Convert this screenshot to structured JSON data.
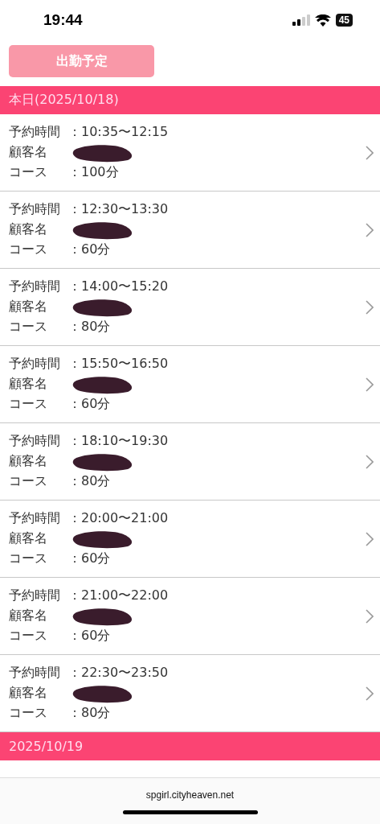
{
  "status_bar": {
    "time": "19:44",
    "battery": "45"
  },
  "schedule_button": {
    "label": "出勤予定"
  },
  "days": [
    {
      "heading": "本日(2025/10/18)",
      "bookings": [
        {
          "time_label": "予約時間",
          "time": "：10:35〜12:15",
          "name_label": "顧客名",
          "course_label": "コース",
          "course": "：100分"
        },
        {
          "time_label": "予約時間",
          "time": "：12:30〜13:30",
          "name_label": "顧客名",
          "course_label": "コース",
          "course": "：60分"
        },
        {
          "time_label": "予約時間",
          "time": "：14:00〜15:20",
          "name_label": "顧客名",
          "course_label": "コース",
          "course": "：80分"
        },
        {
          "time_label": "予約時間",
          "time": "：15:50〜16:50",
          "name_label": "顧客名",
          "course_label": "コース",
          "course": "：60分"
        },
        {
          "time_label": "予約時間",
          "time": "：18:10〜19:30",
          "name_label": "顧客名",
          "course_label": "コース",
          "course": "：80分"
        },
        {
          "time_label": "予約時間",
          "time": "：20:00〜21:00",
          "name_label": "顧客名",
          "course_label": "コース",
          "course": "：60分"
        },
        {
          "time_label": "予約時間",
          "time": "：21:00〜22:00",
          "name_label": "顧客名",
          "course_label": "コース",
          "course": "：60分"
        },
        {
          "time_label": "予約時間",
          "time": "：22:30〜23:50",
          "name_label": "顧客名",
          "course_label": "コース",
          "course": "：80分"
        }
      ]
    },
    {
      "heading": "2025/10/19"
    }
  ],
  "browser_bar": {
    "url": "spgirl.cityheaven.net"
  }
}
